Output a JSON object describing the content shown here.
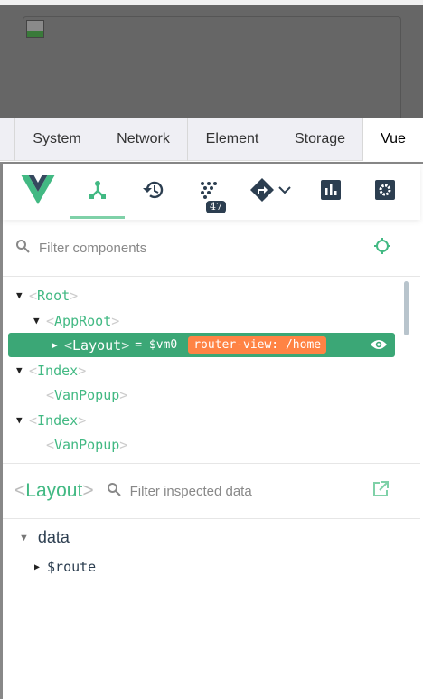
{
  "tabs": [
    "System",
    "Network",
    "Element",
    "Storage",
    "Vue"
  ],
  "toolbar": {
    "events_count": "47"
  },
  "filter": {
    "placeholder": "Filter components"
  },
  "tree": [
    {
      "name": "Root",
      "indent": 0,
      "arrow": "down"
    },
    {
      "name": "AppRoot",
      "indent": 1,
      "arrow": "down"
    },
    {
      "name": "Layout",
      "indent": 2,
      "arrow": "right",
      "selected": true,
      "vm": "= $vm0",
      "tag": "router-view: /home"
    },
    {
      "name": "Index",
      "indent": 0,
      "arrow": "down"
    },
    {
      "name": "VanPopup",
      "indent": 1,
      "arrow": ""
    },
    {
      "name": "Index",
      "indent": 0,
      "arrow": "down"
    },
    {
      "name": "VanPopup",
      "indent": 1,
      "arrow": ""
    }
  ],
  "inspector": {
    "component": "Layout",
    "placeholder": "Filter inspected data",
    "section": "data",
    "key": "$route"
  },
  "colors": {
    "accent": "#42b983",
    "selected": "#3ba776",
    "tag": "#ff8344",
    "dark": "#2c3e50"
  }
}
